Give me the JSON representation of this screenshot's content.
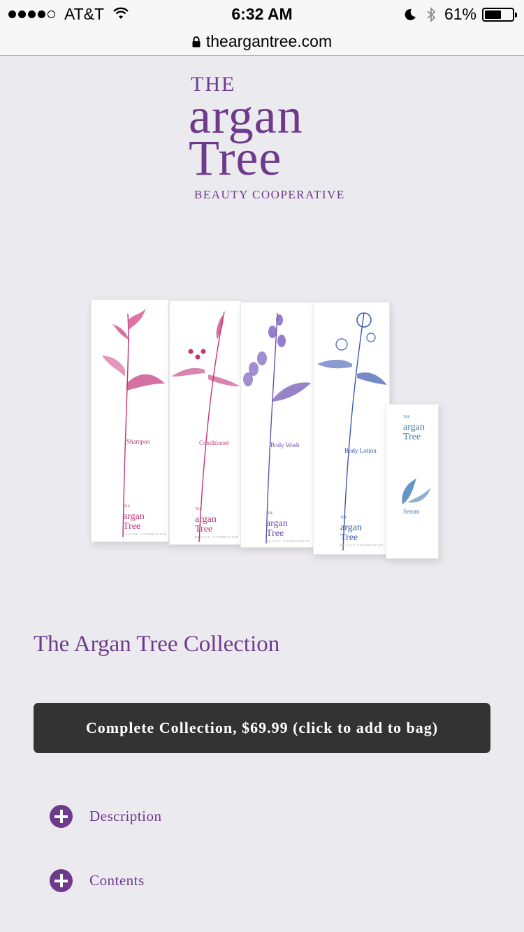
{
  "status_bar": {
    "carrier": "AT&T",
    "time": "6:32 AM",
    "battery": "61%",
    "battery_level": 0.61
  },
  "url_bar": {
    "domain": "theargantree.com"
  },
  "logo": {
    "the": "THE",
    "argan": "argan",
    "tree": "Tree",
    "tagline": "BEAUTY COOPERATIVE"
  },
  "products": [
    {
      "name": "Shampoo",
      "color": "#c2347a"
    },
    {
      "name": "Conditioner",
      "color": "#c2347a"
    },
    {
      "name": "Body Wash",
      "color": "#6a4fb0"
    },
    {
      "name": "Body Lotion",
      "color": "#3c58b0"
    },
    {
      "name": "Serum",
      "color": "#3d7bb5"
    }
  ],
  "product_box_brand": {
    "the": "THE",
    "argan": "argan",
    "tree": "Tree",
    "coop": "BEAUTY COOPERATIVE"
  },
  "main": {
    "title": "The Argan Tree Collection",
    "cta_label": "Complete Collection, $69.99 (click to add to bag)",
    "accordion": [
      {
        "label": "Description"
      },
      {
        "label": "Contents"
      }
    ]
  },
  "colors": {
    "brand": "#6e3a8c",
    "button_bg": "#333333",
    "page_bg": "#ebeaef"
  }
}
